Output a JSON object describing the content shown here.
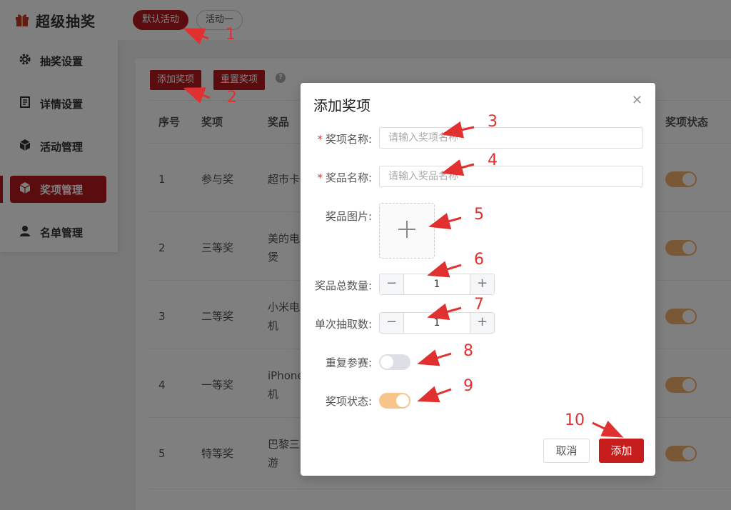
{
  "app": {
    "title": "超级抽奖"
  },
  "tabs": [
    {
      "label": "默认活动",
      "active": true
    },
    {
      "label": "活动一",
      "active": false
    }
  ],
  "sidebar": {
    "items": [
      {
        "label": "抽奖设置",
        "icon": "gear-icon"
      },
      {
        "label": "详情设置",
        "icon": "document-icon"
      },
      {
        "label": "活动管理",
        "icon": "box-icon"
      },
      {
        "label": "奖项管理",
        "icon": "gift-box-icon",
        "active": true
      },
      {
        "label": "名单管理",
        "icon": "user-icon"
      }
    ]
  },
  "toolbar": {
    "add_label": "添加奖项",
    "reset_label": "重置奖项",
    "help_icon": "question-icon"
  },
  "table": {
    "headers": [
      "序号",
      "奖项",
      "奖品",
      "奖项状态"
    ],
    "rows": [
      {
        "index": "1",
        "award": "参与奖",
        "prize_line1": "超市卡",
        "prize_line2": "",
        "status": true
      },
      {
        "index": "2",
        "award": "三等奖",
        "prize_line1": "美的电",
        "prize_line2": "煲",
        "status": true
      },
      {
        "index": "3",
        "award": "二等奖",
        "prize_line1": "小米电",
        "prize_line2": "机",
        "status": true
      },
      {
        "index": "4",
        "award": "一等奖",
        "prize_line1": "iPhone",
        "prize_line2": "机",
        "status": true
      },
      {
        "index": "5",
        "award": "特等奖",
        "prize_line1": "巴黎三",
        "prize_line2": "游",
        "status": true
      }
    ]
  },
  "modal": {
    "title": "添加奖项",
    "close_icon": "close-icon",
    "fields": {
      "award_name_label": "奖项名称:",
      "award_name_placeholder": "请输入奖项名称",
      "prize_name_label": "奖品名称:",
      "prize_name_placeholder": "请输入奖品名称",
      "prize_image_label": "奖品图片:",
      "total_quantity_label": "奖品总数量:",
      "total_quantity_value": "1",
      "per_draw_label": "单次抽取数:",
      "per_draw_value": "1",
      "repeat_label": "重复参赛:",
      "repeat_enabled": false,
      "status_label": "奖项状态:",
      "status_enabled": true
    },
    "required_mark": "*",
    "cancel_label": "取消",
    "submit_label": "添加"
  },
  "annotations": [
    "1",
    "2",
    "3",
    "4",
    "5",
    "6",
    "7",
    "8",
    "9",
    "10"
  ],
  "colors": {
    "brand": "#b5191f",
    "submit": "#c71e1d",
    "toggle_on": "#f7c589",
    "annotation": "#e0302f"
  }
}
